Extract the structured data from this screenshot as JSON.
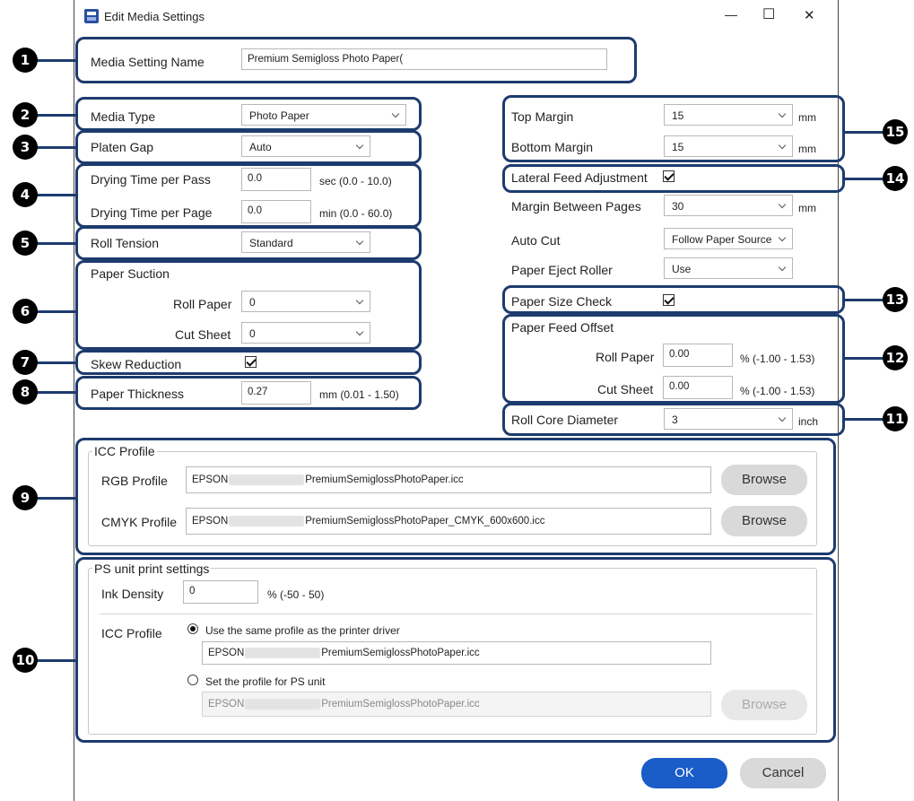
{
  "window": {
    "title": "Edit Media Settings",
    "minimize": "—",
    "maximize": "☐",
    "close": "✕"
  },
  "media_setting_name": {
    "label": "Media Setting Name",
    "value": "Premium Semigloss Photo Paper("
  },
  "media_type": {
    "label": "Media Type",
    "value": "Photo Paper"
  },
  "platen_gap": {
    "label": "Platen Gap",
    "value": "Auto"
  },
  "drying": {
    "pass_label": "Drying Time per Pass",
    "pass_value": "0.0",
    "pass_unit": "sec (0.0 - 10.0)",
    "page_label": "Drying Time per Page",
    "page_value": "0.0",
    "page_unit": "min (0.0 - 60.0)"
  },
  "roll_tension": {
    "label": "Roll Tension",
    "value": "Standard"
  },
  "paper_suction": {
    "title": "Paper Suction",
    "roll_label": "Roll Paper",
    "roll_value": "0",
    "cut_label": "Cut Sheet",
    "cut_value": "0"
  },
  "skew_reduction": {
    "label": "Skew Reduction",
    "checked": true
  },
  "paper_thickness": {
    "label": "Paper Thickness",
    "value": "0.27",
    "unit": "mm (0.01 - 1.50)"
  },
  "margins": {
    "top_label": "Top Margin",
    "top_value": "15",
    "top_unit": "mm",
    "bottom_label": "Bottom Margin",
    "bottom_value": "15",
    "bottom_unit": "mm"
  },
  "lateral_feed": {
    "label": "Lateral Feed Adjustment",
    "checked": true
  },
  "margin_between": {
    "label": "Margin Between Pages",
    "value": "30",
    "unit": "mm"
  },
  "auto_cut": {
    "label": "Auto Cut",
    "value": "Follow Paper Source"
  },
  "eject_roller": {
    "label": "Paper Eject Roller",
    "value": "Use"
  },
  "paper_size_check": {
    "label": "Paper Size Check",
    "checked": true
  },
  "feed_offset": {
    "title": "Paper Feed Offset",
    "roll_label": "Roll Paper",
    "roll_value": "0.00",
    "roll_unit": "% (-1.00 - 1.53)",
    "cut_label": "Cut Sheet",
    "cut_value": "0.00",
    "cut_unit": "% (-1.00 - 1.53)"
  },
  "roll_core": {
    "label": "Roll Core Diameter",
    "value": "3",
    "unit": "inch"
  },
  "icc_profile": {
    "title": "ICC Profile",
    "rgb_label": "RGB Profile",
    "rgb_prefix": "EPSON",
    "rgb_suffix": "PremiumSemiglossPhotoPaper.icc",
    "cmyk_label": "CMYK Profile",
    "cmyk_prefix": "EPSON",
    "cmyk_suffix": "PremiumSemiglossPhotoPaper_CMYK_600x600.icc",
    "browse": "Browse"
  },
  "ps_unit": {
    "title": "PS unit print settings",
    "ink_label": "Ink Density",
    "ink_value": "0",
    "ink_unit": "% (-50 - 50)",
    "icc_label": "ICC Profile",
    "opt1_label": "Use the same profile as the printer driver",
    "opt1_prefix": "EPSON",
    "opt1_suffix": "PremiumSemiglossPhotoPaper.icc",
    "opt2_label": "Set the profile for PS unit",
    "opt2_prefix": "EPSON",
    "opt2_suffix": "PremiumSemiglossPhotoPaper.icc",
    "browse": "Browse",
    "selected_option": 1
  },
  "buttons": {
    "ok": "OK",
    "cancel": "Cancel"
  },
  "callouts": [
    "❶",
    "❷",
    "❸",
    "❹",
    "❺",
    "❻",
    "❼",
    "❽",
    "❾",
    "❿",
    "⓫",
    "⓬",
    "⓭",
    "⓮",
    "⓯"
  ],
  "colors": {
    "highlight": "#1d3b6e",
    "ok_button": "#1a5cc8",
    "window_border": "#444444"
  }
}
